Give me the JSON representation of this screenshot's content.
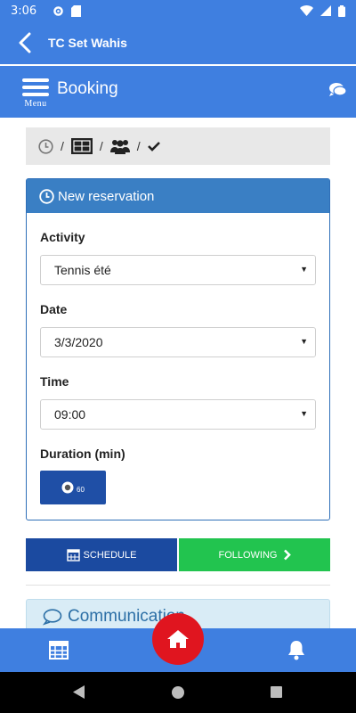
{
  "status_bar": {
    "time": "3:06"
  },
  "app_bar": {
    "title": "TC Set Wahis"
  },
  "header": {
    "menu_label": "Menu",
    "page_title": "Booking"
  },
  "steps": {
    "separator": "/"
  },
  "reservation": {
    "title": "New reservation",
    "activity": {
      "label": "Activity",
      "value": "Tennis été"
    },
    "date": {
      "label": "Date",
      "value": "3/3/2020"
    },
    "time": {
      "label": "Time",
      "value": "09:00"
    },
    "duration": {
      "label": "Duration (min)",
      "value": "60"
    }
  },
  "actions": {
    "schedule_label": "SCHEDULE",
    "following_label": "FOLLOWING"
  },
  "communication": {
    "title": "Communication"
  },
  "colors": {
    "primary": "#3f7fe0",
    "panel_header": "#3a7fc4",
    "schedule": "#1b4aa0",
    "following": "#22c44f",
    "home_fab": "#e0151f"
  }
}
